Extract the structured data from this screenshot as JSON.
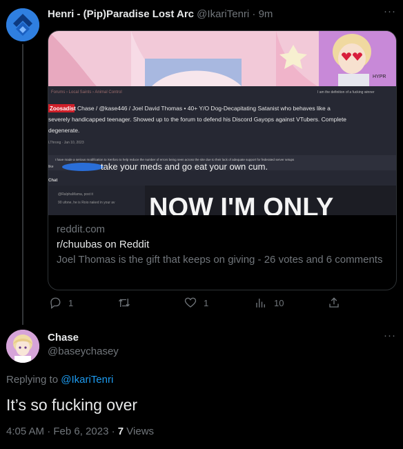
{
  "tweet": {
    "author_name": "Henri - (Pip)Paradise Lost Arc",
    "author_handle": "@IkariTenri",
    "time": "· 9m",
    "more_label": "···",
    "card": {
      "domain": "reddit.com",
      "title": "r/chuubas on Reddit",
      "description": "Joel Thomas is the gift that keeps on giving - 26 votes and 6 comments",
      "image": {
        "breadcrumb": "Forums › Local Saints › Animal Control",
        "corner_note": "I am the definition of a fucking winner",
        "badge": "Zoosadist",
        "post_line1": "Chase / @kase446 / Joel David Thomas • 40+ Y/O Dog-Decapitating Satanist who behaves like a",
        "post_line2": "severely handicapped teenager. Showed up to the forum to defend his Discord Gayops against VTubers. Complete",
        "post_line3": "degenerate.",
        "post_meta": "LThrong · Jan 10, 2023",
        "notice": "I have made a serious modification to Xenforo to help reduce the number of errors being seen across the site due to their lack of adequate support for federated server setups",
        "notice2": "like",
        "caption": "take your meds and go eat your own cum.",
        "chat_label": "Chat",
        "chat_line1": "@RalphaMama, post it",
        "chat_line2": "90 ufone, he is Roio naked in your av",
        "meme_text": "NOW I'M ONLY",
        "sticker_text": "HYPR"
      }
    },
    "actions": {
      "replies": "1",
      "retweets": "",
      "likes": "1",
      "views": "10"
    }
  },
  "reply": {
    "author_name": "Chase",
    "author_handle": "@baseychasey",
    "replying_to_label": "Replying to",
    "replying_to_handle": "@IkariTenri",
    "text": "It’s so fucking over",
    "timestamp": "4:05 AM · Feb 6, 2023 ·",
    "views_count": "7",
    "views_label": "Views",
    "more_label": "···"
  }
}
